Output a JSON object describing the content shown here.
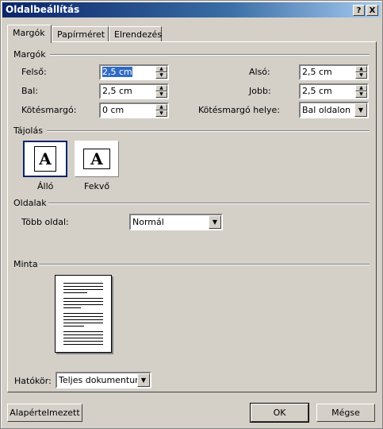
{
  "window": {
    "title": "Oldalbeállítás",
    "help_btn": "?",
    "close_btn": "X"
  },
  "tabs": [
    {
      "label": "Margók",
      "active": true
    },
    {
      "label": "Papírméret",
      "active": false
    },
    {
      "label": "Elrendezés",
      "active": false
    }
  ],
  "margins": {
    "section": "Margók",
    "top_label": "Felső:",
    "top_value": "2,5 cm",
    "bottom_label": "Alsó:",
    "bottom_value": "2,5 cm",
    "left_label": "Bal:",
    "left_value": "2,5 cm",
    "right_label": "Jobb:",
    "right_value": "2,5 cm",
    "gutter_label": "Kötésmargó:",
    "gutter_value": "0 cm",
    "gutter_pos_label": "Kötésmargó helye:",
    "gutter_pos_value": "Bal oldalon"
  },
  "orientation": {
    "section": "Tájolás",
    "portrait_label": "Álló",
    "landscape_label": "Fekvő",
    "glyph": "A",
    "selected": "portrait"
  },
  "pages": {
    "section": "Oldalak",
    "multiple_label": "Több oldal:",
    "multiple_value": "Normál"
  },
  "preview": {
    "section": "Minta"
  },
  "apply": {
    "label": "Hatókör:",
    "value": "Teljes dokumentum"
  },
  "buttons": {
    "default_label": "Alapértelmezett",
    "ok_label": "OK",
    "cancel_label": "Mégse"
  }
}
